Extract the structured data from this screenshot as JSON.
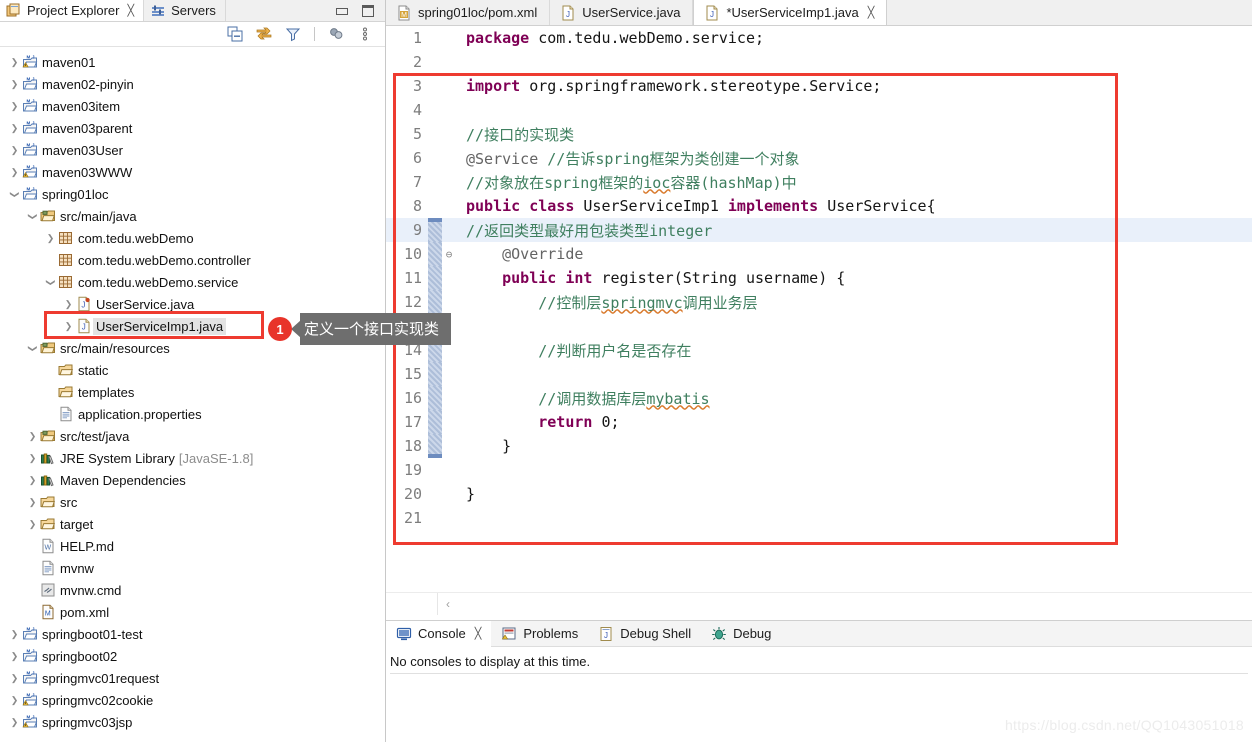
{
  "colors": {
    "accent_red": "#ee3b30",
    "keyword": "#7f0055",
    "comment": "#3f7f5f",
    "annotation": "#646464",
    "line_highlight": "#e9f0fa",
    "callout_bg": "#6e6e6e",
    "badge_bg": "#e8342a"
  },
  "left_panel": {
    "tabs": [
      {
        "label": "Project Explorer",
        "icon": "project-explorer-icon",
        "active": true,
        "closable": true
      },
      {
        "label": "Servers",
        "icon": "servers-icon",
        "active": false,
        "closable": false
      }
    ],
    "window_buttons": [
      {
        "name": "minimize-button",
        "glyph": "minimize"
      },
      {
        "name": "maximize-button",
        "glyph": "maximize"
      }
    ],
    "toolbar": [
      {
        "name": "collapse-all-icon",
        "title": "Collapse All"
      },
      {
        "name": "link-with-editor-icon",
        "title": "Link with Editor"
      },
      {
        "name": "filter-icon",
        "title": "Filters"
      },
      {
        "name": "separator",
        "title": ""
      },
      {
        "name": "view-menu-icon",
        "title": "View Menu"
      },
      {
        "name": "overflow-menu-icon",
        "title": "View Menu"
      }
    ],
    "tree": [
      {
        "label": "maven01",
        "indent": 0,
        "twisty": "collapsed",
        "icon": "maven-project-warn-icon"
      },
      {
        "label": "maven02-pinyin",
        "indent": 0,
        "twisty": "collapsed",
        "icon": "maven-project-icon"
      },
      {
        "label": "maven03item",
        "indent": 0,
        "twisty": "collapsed",
        "icon": "maven-project-icon"
      },
      {
        "label": "maven03parent",
        "indent": 0,
        "twisty": "collapsed",
        "icon": "maven-project-icon"
      },
      {
        "label": "maven03User",
        "indent": 0,
        "twisty": "collapsed",
        "icon": "maven-project-icon"
      },
      {
        "label": "maven03WWW",
        "indent": 0,
        "twisty": "collapsed",
        "icon": "maven-project-warn-icon"
      },
      {
        "label": "spring01loc",
        "indent": 0,
        "twisty": "expanded",
        "icon": "maven-project-icon"
      },
      {
        "label": "src/main/java",
        "indent": 1,
        "twisty": "expanded",
        "icon": "source-folder-icon"
      },
      {
        "label": "com.tedu.webDemo",
        "indent": 2,
        "twisty": "collapsed",
        "icon": "package-icon"
      },
      {
        "label": "com.tedu.webDemo.controller",
        "indent": 2,
        "twisty": "none",
        "icon": "package-icon"
      },
      {
        "label": "com.tedu.webDemo.service",
        "indent": 2,
        "twisty": "expanded",
        "icon": "package-icon"
      },
      {
        "label": "UserService.java",
        "indent": 3,
        "twisty": "collapsed",
        "icon": "java-interface-icon"
      },
      {
        "label": "UserServiceImp1.java",
        "indent": 3,
        "twisty": "collapsed",
        "icon": "java-file-icon",
        "selected": true
      },
      {
        "label": "src/main/resources",
        "indent": 1,
        "twisty": "expanded",
        "icon": "source-folder-icon"
      },
      {
        "label": "static",
        "indent": 2,
        "twisty": "none",
        "icon": "folder-icon"
      },
      {
        "label": "templates",
        "indent": 2,
        "twisty": "none",
        "icon": "folder-icon"
      },
      {
        "label": "application.properties",
        "indent": 2,
        "twisty": "none",
        "icon": "properties-file-icon"
      },
      {
        "label": "src/test/java",
        "indent": 1,
        "twisty": "collapsed",
        "icon": "source-folder-icon"
      },
      {
        "label": "JRE System Library",
        "sub": "[JavaSE-1.8]",
        "indent": 1,
        "twisty": "collapsed",
        "icon": "library-icon"
      },
      {
        "label": "Maven Dependencies",
        "indent": 1,
        "twisty": "collapsed",
        "icon": "library-icon"
      },
      {
        "label": "src",
        "indent": 1,
        "twisty": "collapsed",
        "icon": "folder-icon"
      },
      {
        "label": "target",
        "indent": 1,
        "twisty": "collapsed",
        "icon": "folder-icon"
      },
      {
        "label": "HELP.md",
        "indent": 1,
        "twisty": "none",
        "icon": "markdown-file-icon"
      },
      {
        "label": "mvnw",
        "indent": 1,
        "twisty": "none",
        "icon": "text-file-icon"
      },
      {
        "label": "mvnw.cmd",
        "indent": 1,
        "twisty": "none",
        "icon": "cmd-file-icon"
      },
      {
        "label": "pom.xml",
        "indent": 1,
        "twisty": "none",
        "icon": "maven-pom-icon"
      },
      {
        "label": "springboot01-test",
        "indent": 0,
        "twisty": "collapsed",
        "icon": "maven-project-icon"
      },
      {
        "label": "springboot02",
        "indent": 0,
        "twisty": "collapsed",
        "icon": "maven-project-icon"
      },
      {
        "label": "springmvc01request",
        "indent": 0,
        "twisty": "collapsed",
        "icon": "maven-project-icon"
      },
      {
        "label": "springmvc02cookie",
        "indent": 0,
        "twisty": "collapsed",
        "icon": "maven-project-warn-icon"
      },
      {
        "label": "springmvc03jsp",
        "indent": 0,
        "twisty": "collapsed",
        "icon": "maven-project-warn-icon"
      }
    ]
  },
  "editor": {
    "tabs": [
      {
        "label": "spring01loc/pom.xml",
        "icon": "maven-pom-icon",
        "active": false,
        "closable": false
      },
      {
        "label": "UserService.java",
        "icon": "java-file-icon",
        "active": false,
        "closable": false
      },
      {
        "label": "*UserServiceImp1.java",
        "icon": "java-file-icon",
        "active": true,
        "closable": true
      }
    ],
    "lines": [
      {
        "n": "1",
        "text": "package com.tedu.webDemo.service;"
      },
      {
        "n": "2",
        "text": ""
      },
      {
        "n": "3",
        "text": "import org.springframework.stereotype.Service;"
      },
      {
        "n": "4",
        "text": ""
      },
      {
        "n": "5",
        "text": "//接口的实现类"
      },
      {
        "n": "6",
        "text": "@Service //告诉spring框架为类创建一个对象"
      },
      {
        "n": "7",
        "text": "//对象放在spring框架的ioc容器(hashMap)中"
      },
      {
        "n": "8",
        "text": "public class UserServiceImp1 implements UserService{"
      },
      {
        "n": "9",
        "text": "//返回类型最好用包装类型integer",
        "highlight": true
      },
      {
        "n": "10",
        "text": "    @Override",
        "fold": "collapse"
      },
      {
        "n": "11",
        "text": "    public int register(String username) {"
      },
      {
        "n": "12",
        "text": "        //控制层springmvc调用业务层"
      },
      {
        "n": "13",
        "text": ""
      },
      {
        "n": "14",
        "text": "        //判断用户名是否存在"
      },
      {
        "n": "15",
        "text": ""
      },
      {
        "n": "16",
        "text": "        //调用数据库层mybatis"
      },
      {
        "n": "17",
        "text": "        return 0;"
      },
      {
        "n": "18",
        "text": "    }"
      },
      {
        "n": "19",
        "text": ""
      },
      {
        "n": "20",
        "text": "}"
      },
      {
        "n": "21",
        "text": ""
      }
    ],
    "hscroll_arrow": "‹"
  },
  "bottom_panel": {
    "tabs": [
      {
        "label": "Console",
        "icon": "console-icon",
        "active": true,
        "closable": true
      },
      {
        "label": "Problems",
        "icon": "problems-icon",
        "active": false,
        "closable": false
      },
      {
        "label": "Debug Shell",
        "icon": "debug-shell-icon",
        "active": false,
        "closable": false
      },
      {
        "label": "Debug",
        "icon": "debug-icon",
        "active": false,
        "closable": false
      }
    ],
    "message": "No consoles to display at this time."
  },
  "annotation": {
    "badge": "1",
    "text": "定义一个接口实现类"
  },
  "watermark": "https://blog.csdn.net/QQ1043051018"
}
